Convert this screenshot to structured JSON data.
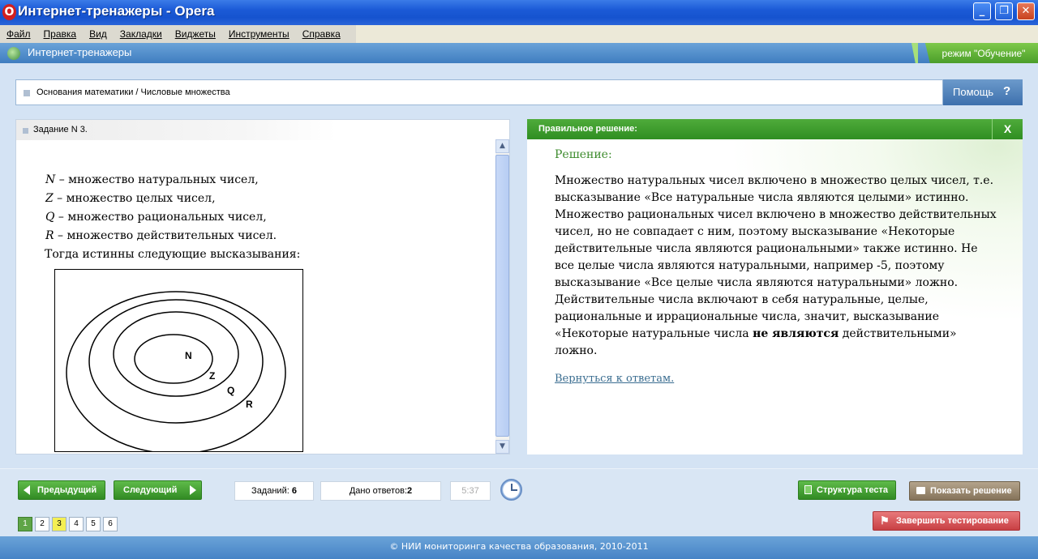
{
  "window": {
    "title": "Интернет-тренажеры - Opera",
    "logo": "O"
  },
  "menu": [
    "Файл",
    "Правка",
    "Вид",
    "Закладки",
    "Виджеты",
    "Инструменты",
    "Справка"
  ],
  "appbar": {
    "title": "Интернет-тренажеры",
    "mode": "режим \"Обучение\""
  },
  "breadcrumb": "Основания математики / Числовые множества",
  "help": {
    "label": "Помощь",
    "icon": "?"
  },
  "task": {
    "header": "Задание N 3.",
    "lines": [
      {
        "var": "N",
        "text": " – множество натуральных чисел,"
      },
      {
        "var": "Z",
        "text": "  – множество целых чисел,"
      },
      {
        "var": "Q",
        "text": " – множество рациональных чисел,"
      },
      {
        "var": "R",
        "text": "  – множество действительных чисел."
      }
    ],
    "conclusion": "Тогда истинны следующие высказывания:",
    "diagram_labels": [
      "N",
      "Z",
      "Q",
      "R"
    ]
  },
  "solution": {
    "header": "Правильное решение:",
    "close": "X",
    "heading": "Решение:",
    "text_before_bold": "Множество натуральных чисел включено в множество целых чисел, т.е. высказывание «Все натуральные числа являются целыми» истинно. Множество рациональных чисел включено в множество действительных чисел, но не совпадает с ним, поэтому  высказывание «Некоторые действительные числа являются рациональными» также истинно. Не все целые числа являются натуральными, например -5, поэтому высказывание «Все целые числа являются натуральными»  ложно. Действительные числа включают в себя  натуральные, целые,  рациональные и иррациональные числа, значит, высказывание «Некоторые натуральные числа ",
    "bold": "не являются",
    "text_after_bold": " действительными» ложно.",
    "back_link": "Вернуться к ответам."
  },
  "nav": {
    "prev": "Предыдущий",
    "next": "Следующий",
    "tasks_label": "Заданий:",
    "tasks_value": "6",
    "answers_label": "Дано ответов:",
    "answers_value": "2",
    "timer": "5:37",
    "structure": "Структура теста",
    "show_solution": "Показать решение",
    "finish": "Завершить тестирование",
    "pages": [
      "1",
      "2",
      "3",
      "4",
      "5",
      "6"
    ]
  },
  "footer": "© НИИ мониторинга качества образования, 2010-2011",
  "colors": {
    "accent_green": "#3f9a2e",
    "accent_blue": "#3f7dc0",
    "finish_red": "#c84044",
    "current_page": "#f4ef53",
    "answered_page": "#5fa547"
  }
}
